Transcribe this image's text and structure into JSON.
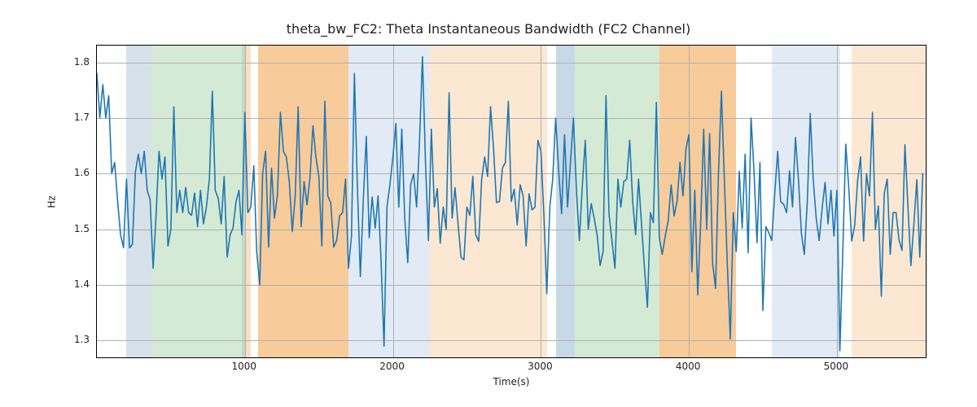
{
  "chart_data": {
    "type": "line",
    "title": "theta_bw_FC2: Theta Instantaneous Bandwidth (FC2 Channel)",
    "xlabel": "Time(s)",
    "ylabel": "Hz",
    "xlim": [
      0,
      5600
    ],
    "ylim": [
      1.27,
      1.83
    ],
    "x_ticks": [
      1000,
      2000,
      3000,
      4000,
      5000
    ],
    "y_ticks": [
      1.3,
      1.4,
      1.5,
      1.6,
      1.7,
      1.8
    ],
    "bands": [
      {
        "start": 200,
        "end": 370,
        "color": "#d6e1ea",
        "alpha": 1.0
      },
      {
        "start": 370,
        "end": 980,
        "color": "#d5ead5",
        "alpha": 1.0
      },
      {
        "start": 980,
        "end": 1000,
        "color": "#c4dac4",
        "alpha": 1.0
      },
      {
        "start": 1000,
        "end": 1040,
        "color": "#f9e0c4",
        "alpha": 1.0
      },
      {
        "start": 1090,
        "end": 1700,
        "color": "#f8cb9b",
        "alpha": 1.0
      },
      {
        "start": 1700,
        "end": 2250,
        "color": "#e2ebf5",
        "alpha": 1.0
      },
      {
        "start": 2250,
        "end": 3040,
        "color": "#fce8d2",
        "alpha": 1.0
      },
      {
        "start": 3100,
        "end": 3230,
        "color": "#c8d9e6",
        "alpha": 1.0
      },
      {
        "start": 3230,
        "end": 3800,
        "color": "#d5ead5",
        "alpha": 1.0
      },
      {
        "start": 3800,
        "end": 4320,
        "color": "#f8cb9b",
        "alpha": 1.0
      },
      {
        "start": 4560,
        "end": 5020,
        "color": "#e2ebf5",
        "alpha": 1.0
      },
      {
        "start": 5100,
        "end": 5600,
        "color": "#fce8d2",
        "alpha": 1.0
      }
    ],
    "series": [
      {
        "name": "theta_bw_FC2",
        "color": "#1f77b4",
        "x_step": 20,
        "y": [
          1.78,
          1.7,
          1.76,
          1.7,
          1.74,
          1.6,
          1.62,
          1.55,
          1.49,
          1.467,
          1.59,
          1.467,
          1.473,
          1.603,
          1.635,
          1.6,
          1.64,
          1.57,
          1.553,
          1.43,
          1.525,
          1.64,
          1.59,
          1.63,
          1.47,
          1.5,
          1.72,
          1.53,
          1.57,
          1.53,
          1.575,
          1.53,
          1.525,
          1.565,
          1.505,
          1.57,
          1.51,
          1.54,
          1.59,
          1.748,
          1.57,
          1.555,
          1.51,
          1.595,
          1.45,
          1.49,
          1.502,
          1.55,
          1.57,
          1.49,
          1.71,
          1.53,
          1.54,
          1.614,
          1.46,
          1.4,
          1.6,
          1.64,
          1.468,
          1.61,
          1.52,
          1.562,
          1.71,
          1.64,
          1.63,
          1.586,
          1.496,
          1.56,
          1.72,
          1.505,
          1.586,
          1.544,
          1.594,
          1.686,
          1.63,
          1.594,
          1.47,
          1.73,
          1.56,
          1.548,
          1.468,
          1.48,
          1.524,
          1.53,
          1.59,
          1.43,
          1.488,
          1.78,
          1.579,
          1.415,
          1.552,
          1.667,
          1.485,
          1.558,
          1.502,
          1.56,
          1.445,
          1.29,
          1.54,
          1.58,
          1.63,
          1.69,
          1.54,
          1.68,
          1.52,
          1.44,
          1.58,
          1.6,
          1.54,
          1.66,
          1.81,
          1.62,
          1.48,
          1.68,
          1.54,
          1.573,
          1.475,
          1.54,
          1.5,
          1.745,
          1.52,
          1.575,
          1.51,
          1.45,
          1.445,
          1.54,
          1.525,
          1.595,
          1.49,
          1.478,
          1.59,
          1.63,
          1.595,
          1.72,
          1.645,
          1.548,
          1.55,
          1.61,
          1.62,
          1.73,
          1.55,
          1.572,
          1.508,
          1.58,
          1.56,
          1.47,
          1.564,
          1.535,
          1.54,
          1.66,
          1.64,
          1.527,
          1.384,
          1.54,
          1.59,
          1.7,
          1.605,
          1.528,
          1.67,
          1.54,
          1.62,
          1.7,
          1.57,
          1.48,
          1.58,
          1.66,
          1.5,
          1.546,
          1.52,
          1.49,
          1.435,
          1.46,
          1.74,
          1.528,
          1.48,
          1.43,
          1.59,
          1.54,
          1.586,
          1.59,
          1.66,
          1.55,
          1.49,
          1.59,
          1.508,
          1.43,
          1.36,
          1.53,
          1.512,
          1.728,
          1.485,
          1.455,
          1.488,
          1.515,
          1.58,
          1.524,
          1.55,
          1.62,
          1.56,
          1.644,
          1.67,
          1.424,
          1.57,
          1.382,
          1.515,
          1.68,
          1.5,
          1.672,
          1.44,
          1.394,
          1.602,
          1.748,
          1.584,
          1.435,
          1.303,
          1.53,
          1.46,
          1.604,
          1.502,
          1.635,
          1.458,
          1.7,
          1.605,
          1.476,
          1.62,
          1.354,
          1.505,
          1.494,
          1.48,
          1.565,
          1.64,
          1.55,
          1.545,
          1.53,
          1.605,
          1.54,
          1.665,
          1.59,
          1.493,
          1.455,
          1.55,
          1.708,
          1.59,
          1.52,
          1.48,
          1.538,
          1.584,
          1.51,
          1.57,
          1.488,
          1.57,
          1.282,
          1.462,
          1.653,
          1.575,
          1.479,
          1.506,
          1.588,
          1.63,
          1.479,
          1.6,
          1.56,
          1.71,
          1.5,
          1.542,
          1.38,
          1.565,
          1.59,
          1.455,
          1.53,
          1.53,
          1.48,
          1.462,
          1.652,
          1.54,
          1.435,
          1.51,
          1.589,
          1.45,
          1.6
        ]
      }
    ]
  }
}
